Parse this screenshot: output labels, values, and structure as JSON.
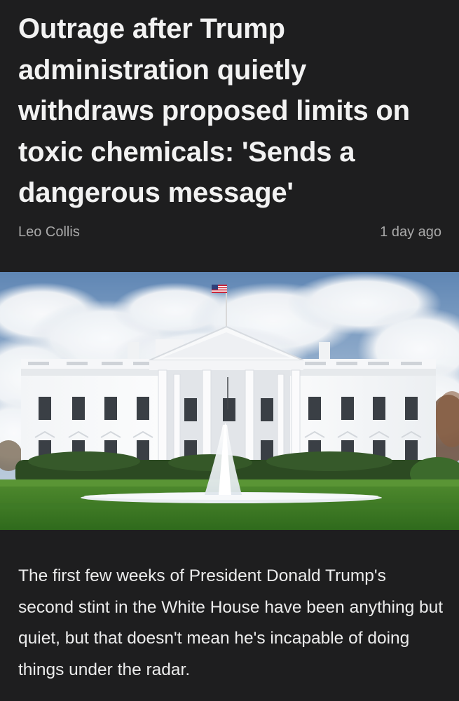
{
  "article": {
    "headline": "Outrage after Trump administration quietly withdraws proposed limits on toxic chemicals: 'Sends a dangerous message'",
    "author": "Leo Collis",
    "published": "1 day ago",
    "body": "The first few weeks of President Donald Trump's second stint in the White House have been anything but quiet, but that doesn't mean he's incapable of doing things under the radar."
  },
  "colors": {
    "background": "#1e1e1f",
    "headline_text": "#f2f2f2",
    "meta_text": "#a9a9a9",
    "body_text": "#ececec"
  }
}
